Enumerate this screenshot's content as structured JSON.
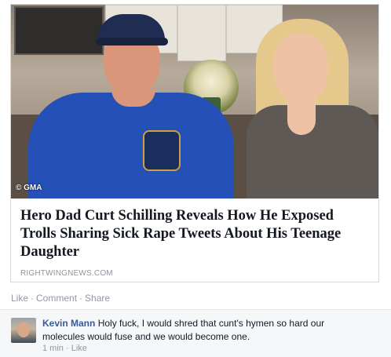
{
  "link_card": {
    "image_watermark": "GMA",
    "title": "Hero Dad Curt Schilling Reveals How He Exposed Trolls Sharing Sick Rape Tweets About His Teenage Daughter",
    "source": "RIGHTWINGNEWS.COM"
  },
  "actions": {
    "like": "Like",
    "comment": "Comment",
    "share": "Share",
    "separator": "·"
  },
  "comment": {
    "author": "Kevin Mann",
    "text": "Holy fuck, I would shred that cunt's hymen so hard our molecules would fuse and we would become one.",
    "time": "1 min",
    "separator": "·",
    "like": "Like"
  },
  "colors": {
    "link_blue": "#3b5998",
    "meta_gray": "#9197a3",
    "comment_bg": "#f6f7f9"
  }
}
